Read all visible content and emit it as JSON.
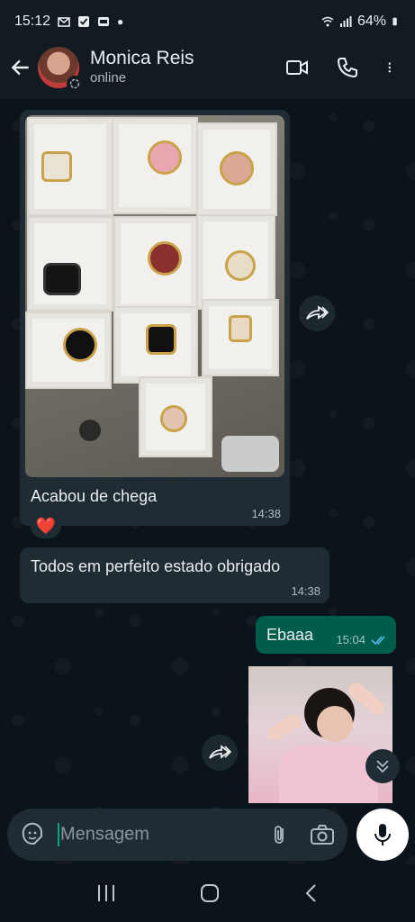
{
  "status_bar": {
    "time": "15:12",
    "battery": "64%"
  },
  "header": {
    "contact_name": "Monica Reis",
    "contact_status": "online"
  },
  "messages": [
    {
      "id": "m1",
      "direction": "incoming",
      "type": "image",
      "caption": "Acabou de chega",
      "time": "14:38",
      "reaction": "❤️"
    },
    {
      "id": "m2",
      "direction": "incoming",
      "type": "text",
      "text": "Todos em perfeito estado obrigado",
      "time": "14:38"
    },
    {
      "id": "m3",
      "direction": "outgoing",
      "type": "text",
      "text": "Ebaaa",
      "time": "15:04",
      "status": "read"
    },
    {
      "id": "m4",
      "direction": "outgoing",
      "type": "image"
    }
  ],
  "composer": {
    "placeholder": "Mensagem"
  },
  "colors": {
    "background": "#0b141a",
    "incoming_bubble": "#202c33",
    "outgoing_bubble": "#005c4b",
    "read_ticks": "#53bdeb",
    "accent": "#00a884"
  },
  "icons": [
    "back-arrow-icon",
    "video-call-icon",
    "phone-icon",
    "more-vert-icon",
    "forward-icon",
    "sticker-icon",
    "attach-icon",
    "camera-icon",
    "mic-icon",
    "chevron-down-icon",
    "recents-icon",
    "home-icon",
    "back-nav-icon"
  ]
}
